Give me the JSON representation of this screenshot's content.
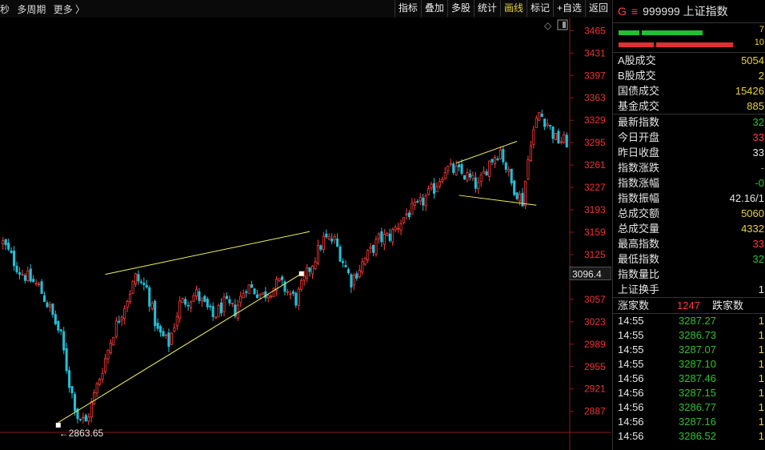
{
  "toolbar": {
    "left_items": [
      "秒",
      "多周期",
      "更多 〉"
    ],
    "buttons": [
      "指标",
      "叠加",
      "多股",
      "统计",
      "画线",
      "标记",
      "+自选",
      "返回"
    ],
    "active_button": "画线"
  },
  "chart_data": {
    "type": "candlestick",
    "ylim": [
      2855,
      3480
    ],
    "y_ticks": [
      3465,
      3431,
      3397,
      3363,
      3329,
      3295,
      3261,
      3227,
      3193,
      3159,
      3125,
      3091,
      3057,
      3023,
      2989,
      2955,
      2921,
      2887
    ],
    "current_price_label": "3096.4",
    "current_price": 3096.4,
    "low_annotation": "←2863.65",
    "low_value": 2863.65,
    "up_color": "#ff3b3b",
    "down_color": "#22c0d8",
    "trendline_color": "#f0f05a",
    "n_bars": 205,
    "path": [
      [
        0,
        3143
      ],
      [
        6,
        3100
      ],
      [
        13,
        3076
      ],
      [
        17,
        3042
      ],
      [
        21,
        3000
      ],
      [
        24,
        2930
      ],
      [
        27,
        2880
      ],
      [
        30,
        2870
      ],
      [
        34,
        2925
      ],
      [
        40,
        3008
      ],
      [
        48,
        3090
      ],
      [
        52,
        3073
      ],
      [
        56,
        3008
      ],
      [
        60,
        2990
      ],
      [
        64,
        3050
      ],
      [
        70,
        3065
      ],
      [
        76,
        3030
      ],
      [
        80,
        3050
      ],
      [
        84,
        3040
      ],
      [
        88,
        3078
      ],
      [
        94,
        3063
      ],
      [
        100,
        3082
      ],
      [
        106,
        3056
      ],
      [
        110,
        3095
      ],
      [
        116,
        3148
      ],
      [
        120,
        3146
      ],
      [
        126,
        3085
      ],
      [
        130,
        3112
      ],
      [
        136,
        3148
      ],
      [
        140,
        3153
      ],
      [
        146,
        3187
      ],
      [
        150,
        3197
      ],
      [
        156,
        3226
      ],
      [
        160,
        3256
      ],
      [
        164,
        3252
      ],
      [
        168,
        3243
      ],
      [
        172,
        3228
      ],
      [
        176,
        3266
      ],
      [
        180,
        3284
      ],
      [
        184,
        3233
      ],
      [
        188,
        3206
      ],
      [
        191,
        3300
      ],
      [
        194,
        3340
      ],
      [
        197,
        3325
      ],
      [
        200,
        3300
      ],
      [
        204,
        3296
      ]
    ],
    "trendlines": [
      {
        "from": [
          37,
          3095
        ],
        "to": [
          111,
          3160
        ]
      },
      {
        "from": [
          20,
          2870
        ],
        "to": [
          108,
          3096
        ]
      },
      {
        "from": [
          164,
          3264
        ],
        "to": [
          186,
          3297
        ]
      },
      {
        "from": [
          165,
          3215
        ],
        "to": [
          193,
          3200
        ]
      }
    ],
    "markers": [
      [
        20,
        2866
      ],
      [
        108,
        3096
      ]
    ]
  },
  "panel": {
    "title_prefix": "G",
    "menu_glyph": "≡",
    "title": "999999 上证指数",
    "bar_numbers": [
      "7",
      "10"
    ],
    "rows1": [
      {
        "label": "A股成交",
        "value": "5054",
        "color": "yl"
      },
      {
        "label": "B股成交",
        "value": "2",
        "color": "yl"
      },
      {
        "label": "国债成交",
        "value": "15426",
        "color": "yl"
      },
      {
        "label": "基金成交",
        "value": "885",
        "color": "yl"
      }
    ],
    "rows2": [
      {
        "label": "最新指数",
        "value": "32",
        "color": "gr"
      },
      {
        "label": "今日开盘",
        "value": "33",
        "color": "rd"
      },
      {
        "label": "昨日收盘",
        "value": "33",
        "color": "wh"
      },
      {
        "label": "指数涨跌",
        "value": "-",
        "color": "gr"
      },
      {
        "label": "指数涨幅",
        "value": "-0",
        "color": "gr"
      },
      {
        "label": "指数振幅",
        "value": "42.16/1",
        "color": "wh"
      },
      {
        "label": "总成交额",
        "value": "5060",
        "color": "yl"
      },
      {
        "label": "总成交量",
        "value": "4332",
        "color": "yl"
      },
      {
        "label": "最高指数",
        "value": "33",
        "color": "rd"
      },
      {
        "label": "最低指数",
        "value": "32",
        "color": "gr"
      },
      {
        "label": "指数量比",
        "value": "",
        "color": "wh"
      },
      {
        "label": "上证换手",
        "value": "1",
        "color": "wh"
      }
    ],
    "updown": {
      "up_label": "涨家数",
      "up_count": "1247",
      "down_label": "跌家数"
    },
    "ticks": [
      {
        "time": "14:55",
        "price": "3287.27",
        "vol": "1"
      },
      {
        "time": "14:55",
        "price": "3286.73",
        "vol": "1"
      },
      {
        "time": "14:55",
        "price": "3287.07",
        "vol": "1"
      },
      {
        "time": "14:55",
        "price": "3287.10",
        "vol": "1"
      },
      {
        "time": "14:56",
        "price": "3287.46",
        "vol": "1"
      },
      {
        "time": "14:56",
        "price": "3287.15",
        "vol": "1"
      },
      {
        "time": "14:56",
        "price": "3286.77",
        "vol": "1"
      },
      {
        "time": "14:56",
        "price": "3287.16",
        "vol": "1"
      },
      {
        "time": "14:56",
        "price": "3286.52",
        "vol": "1"
      }
    ]
  }
}
